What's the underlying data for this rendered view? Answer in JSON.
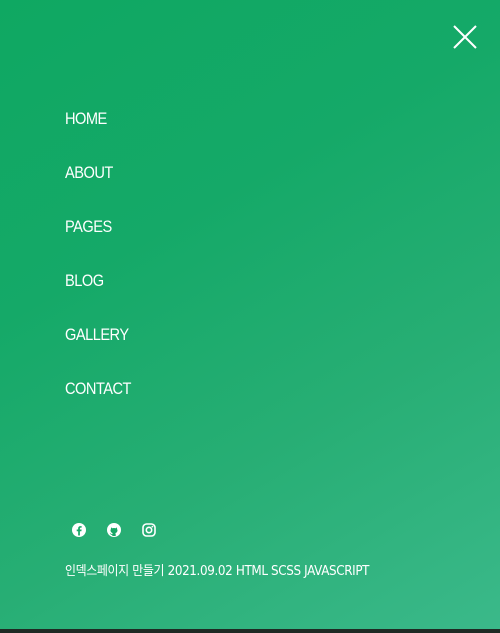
{
  "close_button": {
    "icon": "close-icon"
  },
  "menu": {
    "items": [
      {
        "label": "HOME"
      },
      {
        "label": "ABOUT"
      },
      {
        "label": "PAGES"
      },
      {
        "label": "BLOG"
      },
      {
        "label": "GALLERY"
      },
      {
        "label": "CONTACT"
      }
    ]
  },
  "social": {
    "icons": [
      "facebook-icon",
      "github-icon",
      "instagram-icon"
    ]
  },
  "footer": {
    "text": "인덱스페이지 만들기 2021.09.02 HTML SCSS JAVASCRIPT"
  },
  "colors": {
    "gradient_start": "#0fa862",
    "gradient_end": "#3bb98a",
    "text": "#ffffff"
  }
}
